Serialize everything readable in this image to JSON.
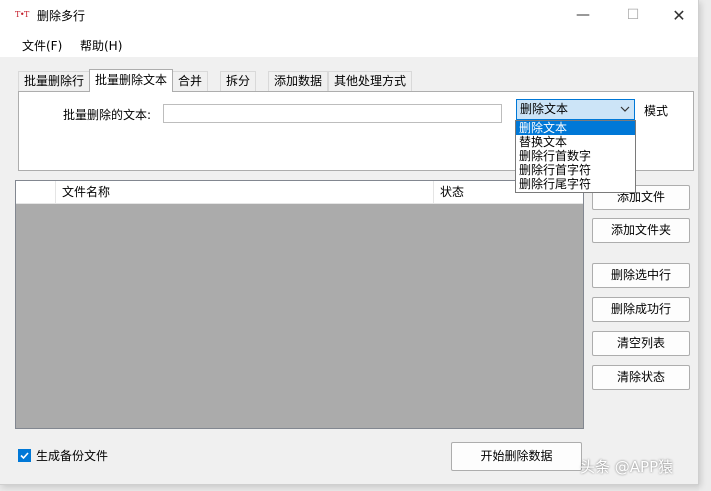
{
  "window": {
    "icon_text": "T•T",
    "title": "删除多行",
    "min_glyph": "—",
    "max_glyph": "☐",
    "close_glyph": "✕"
  },
  "menu": {
    "file": "文件(F)",
    "help": "帮助(H)"
  },
  "tabs": [
    "批量删除行",
    "批量删除文本",
    "合并",
    "拆分",
    "添加数据",
    "其他处理方式"
  ],
  "form": {
    "text_label": "批量删除的文本:",
    "text_value": "",
    "mode_label": "模式",
    "mode_selected": "删除文本"
  },
  "mode_options": [
    "删除文本",
    "替换文本",
    "删除行首数字",
    "删除行首字符",
    "删除行尾字符"
  ],
  "list": {
    "columns": [
      "",
      "文件名称",
      "状态"
    ]
  },
  "buttons": {
    "add_file": "添加文件",
    "add_folder": "添加文件夹",
    "delete_selected": "删除选中行",
    "delete_success": "删除成功行",
    "clear_list": "清空列表",
    "clear_status": "清除状态",
    "start": "开始删除数据"
  },
  "backup": {
    "label": "生成备份文件",
    "checked": true
  },
  "watermark": "头条 @APP猿",
  "colors": {
    "accent": "#0078d7",
    "list_bg": "#ababab",
    "icon_red": "#c41e2a"
  }
}
